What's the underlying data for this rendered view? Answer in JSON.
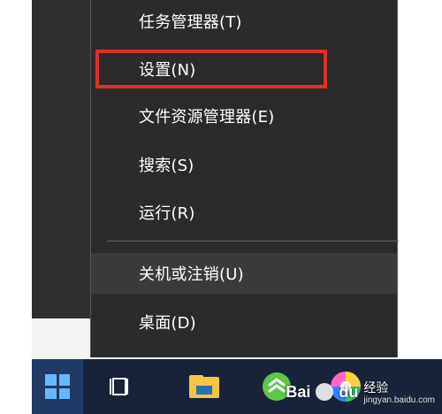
{
  "menu": {
    "items": [
      {
        "label": "任务管理器(T)"
      },
      {
        "label": "设置(N)"
      },
      {
        "label": "文件资源管理器(E)"
      },
      {
        "label": "搜索(S)"
      },
      {
        "label": "运行(R)"
      },
      {
        "label": "关机或注销(U)"
      },
      {
        "label": "桌面(D)"
      }
    ]
  },
  "taskbar": {
    "icons": [
      {
        "icon": "windows-start-icon"
      },
      {
        "icon": "task-view-icon"
      },
      {
        "icon": "file-explorer-icon"
      },
      {
        "icon": "browser-icon"
      },
      {
        "icon": "colorful-app-icon"
      }
    ]
  },
  "watermark": {
    "brand": "Bai",
    "brand_suffix": "du",
    "cn": "经验",
    "sub": "jingyan.baidu.com"
  },
  "colors": {
    "menu_bg": "#2b2b2b",
    "highlight_red": "#e0302b",
    "taskbar_bg": "#18233a",
    "start_blue": "#67b7ff"
  }
}
